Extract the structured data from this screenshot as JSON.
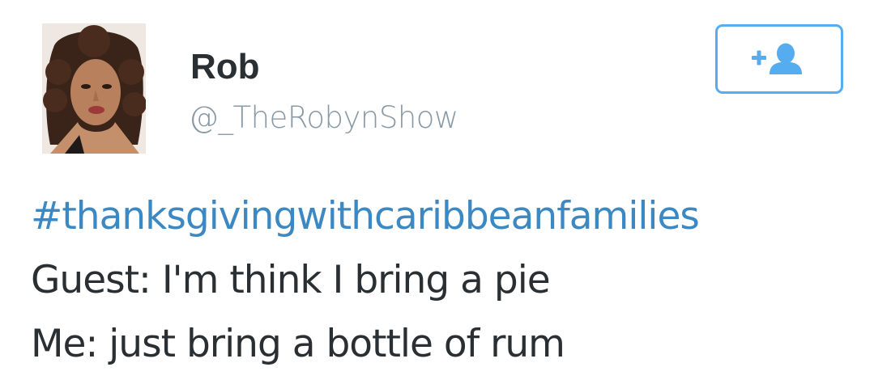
{
  "tweet": {
    "display_name": "Rob",
    "handle": "@_TheRobynShow",
    "hashtag": "#thanksgivingwithcaribbeanfamilies",
    "lines": [
      "Guest: I'm think I bring a pie",
      "Me: just bring a bottle of rum"
    ]
  },
  "follow_button": {
    "icon": "add-user-icon",
    "plus_glyph": "+"
  },
  "colors": {
    "accent": "#55acee",
    "hashtag": "#3b88c3",
    "text": "#292f33",
    "handle": "#8899a6"
  }
}
